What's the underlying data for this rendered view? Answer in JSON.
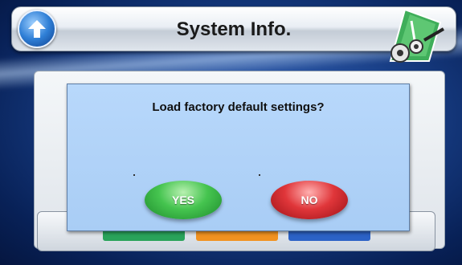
{
  "header": {
    "title": "System Info."
  },
  "dialog": {
    "question": "Load factory default settings?",
    "yes_label": "YES",
    "no_label": "NO"
  },
  "icons": {
    "back": "up-arrow-icon",
    "corner": "settings-gears-icon"
  },
  "colors": {
    "yes_button": "#45c44f",
    "no_button": "#e0363a",
    "dialog_bg": "#b8d8fb",
    "tab_green": "#29a35a",
    "tab_orange": "#f19220",
    "tab_blue": "#2c62c6"
  }
}
